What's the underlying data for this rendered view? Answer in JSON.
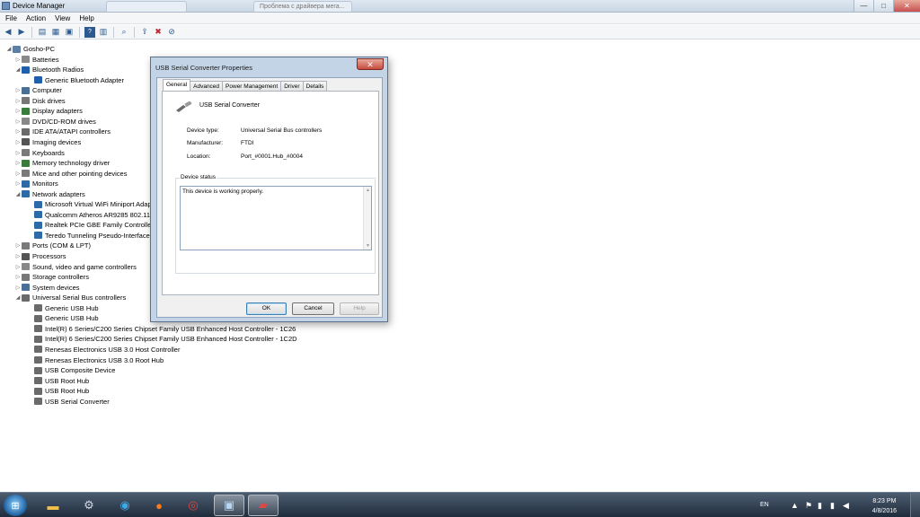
{
  "window": {
    "title": "Device Manager",
    "background_tab_1": "",
    "background_tab_2": "Проблема с драйвера мега...",
    "minimize_glyph": "—",
    "maximize_glyph": "□",
    "close_glyph": "✕"
  },
  "menu": [
    "File",
    "Action",
    "View",
    "Help"
  ],
  "tree": {
    "root": "Gosho-PC",
    "items": [
      {
        "label": "Batteries",
        "level": 1,
        "expander": "▷",
        "icon": "battery-icon",
        "color": "#8a8a8a"
      },
      {
        "label": "Bluetooth Radios",
        "level": 1,
        "expander": "◢",
        "icon": "bluetooth-icon",
        "color": "#1f5fae"
      },
      {
        "label": "Generic Bluetooth Adapter",
        "level": 2,
        "expander": "",
        "icon": "bluetooth-device-icon",
        "color": "#1f5fae"
      },
      {
        "label": "Computer",
        "level": 1,
        "expander": "▷",
        "icon": "computer-icon",
        "color": "#4a6f96"
      },
      {
        "label": "Disk drives",
        "level": 1,
        "expander": "▷",
        "icon": "disk-drive-icon",
        "color": "#777777"
      },
      {
        "label": "Display adapters",
        "level": 1,
        "expander": "▷",
        "icon": "display-adapter-icon",
        "color": "#3a7d3a"
      },
      {
        "label": "DVD/CD-ROM drives",
        "level": 1,
        "expander": "▷",
        "icon": "dvd-drive-icon",
        "color": "#888888"
      },
      {
        "label": "IDE ATA/ATAPI controllers",
        "level": 1,
        "expander": "▷",
        "icon": "ide-controller-icon",
        "color": "#6a6a6a"
      },
      {
        "label": "Imaging devices",
        "level": 1,
        "expander": "▷",
        "icon": "camera-icon",
        "color": "#555555"
      },
      {
        "label": "Keyboards",
        "level": 1,
        "expander": "▷",
        "icon": "keyboard-icon",
        "color": "#7a7a7a"
      },
      {
        "label": "Memory technology driver",
        "level": 1,
        "expander": "▷",
        "icon": "memory-icon",
        "color": "#3a7d3a"
      },
      {
        "label": "Mice and other pointing devices",
        "level": 1,
        "expander": "▷",
        "icon": "mouse-icon",
        "color": "#7a7a7a"
      },
      {
        "label": "Monitors",
        "level": 1,
        "expander": "▷",
        "icon": "monitor-icon",
        "color": "#2d6aa8"
      },
      {
        "label": "Network adapters",
        "level": 1,
        "expander": "◢",
        "icon": "network-adapter-icon",
        "color": "#2d6aa8"
      },
      {
        "label": "Microsoft Virtual WiFi Miniport Adapter",
        "level": 2,
        "expander": "",
        "icon": "network-card-icon",
        "color": "#2d6aa8"
      },
      {
        "label": "Qualcomm Atheros AR9285 802.11b/g/n WiFi Adapter",
        "level": 2,
        "expander": "",
        "icon": "network-card-icon",
        "color": "#2d6aa8"
      },
      {
        "label": "Realtek PCIe GBE Family Controller",
        "level": 2,
        "expander": "",
        "icon": "network-card-icon",
        "color": "#2d6aa8"
      },
      {
        "label": "Teredo Tunneling Pseudo-Interface",
        "level": 2,
        "expander": "",
        "icon": "network-card-icon",
        "color": "#2d6aa8"
      },
      {
        "label": "Ports (COM & LPT)",
        "level": 1,
        "expander": "▷",
        "icon": "port-icon",
        "color": "#7a7a7a"
      },
      {
        "label": "Processors",
        "level": 1,
        "expander": "▷",
        "icon": "processor-icon",
        "color": "#555555"
      },
      {
        "label": "Sound, video and game controllers",
        "level": 1,
        "expander": "▷",
        "icon": "speaker-icon",
        "color": "#888888"
      },
      {
        "label": "Storage controllers",
        "level": 1,
        "expander": "▷",
        "icon": "storage-controller-icon",
        "color": "#777777"
      },
      {
        "label": "System devices",
        "level": 1,
        "expander": "▷",
        "icon": "system-device-icon",
        "color": "#4a6f96"
      },
      {
        "label": "Universal Serial Bus controllers",
        "level": 1,
        "expander": "◢",
        "icon": "usb-controller-icon",
        "color": "#6a6a6a"
      },
      {
        "label": "Generic USB Hub",
        "level": 2,
        "expander": "",
        "icon": "usb-plug-icon",
        "color": "#6a6a6a"
      },
      {
        "label": "Generic USB Hub",
        "level": 2,
        "expander": "",
        "icon": "usb-plug-icon",
        "color": "#6a6a6a"
      },
      {
        "label": "Intel(R) 6 Series/C200 Series Chipset Family USB Enhanced Host Controller - 1C26",
        "level": 2,
        "expander": "",
        "icon": "usb-plug-icon",
        "color": "#6a6a6a"
      },
      {
        "label": "Intel(R) 6 Series/C200 Series Chipset Family USB Enhanced Host Controller - 1C2D",
        "level": 2,
        "expander": "",
        "icon": "usb-plug-icon",
        "color": "#6a6a6a"
      },
      {
        "label": "Renesas Electronics USB 3.0 Host Controller",
        "level": 2,
        "expander": "",
        "icon": "usb-plug-icon",
        "color": "#6a6a6a"
      },
      {
        "label": "Renesas Electronics USB 3.0 Root Hub",
        "level": 2,
        "expander": "",
        "icon": "usb-plug-icon",
        "color": "#6a6a6a"
      },
      {
        "label": "USB Composite Device",
        "level": 2,
        "expander": "",
        "icon": "usb-plug-icon",
        "color": "#6a6a6a"
      },
      {
        "label": "USB Root Hub",
        "level": 2,
        "expander": "",
        "icon": "usb-plug-icon",
        "color": "#6a6a6a"
      },
      {
        "label": "USB Root Hub",
        "level": 2,
        "expander": "",
        "icon": "usb-plug-icon",
        "color": "#6a6a6a"
      },
      {
        "label": "USB Serial Converter",
        "level": 2,
        "expander": "",
        "icon": "usb-plug-icon",
        "color": "#6a6a6a"
      }
    ]
  },
  "dialog": {
    "title": "USB Serial Converter Properties",
    "close_glyph": "✕",
    "tabs": [
      "General",
      "Advanced",
      "Power Management",
      "Driver",
      "Details"
    ],
    "active_tab": "General",
    "device_name": "USB Serial Converter",
    "device_type_label": "Device type:",
    "device_type_value": "Universal Serial Bus controllers",
    "manufacturer_label": "Manufacturer:",
    "manufacturer_value": "FTDI",
    "location_label": "Location:",
    "location_value": "Port_#0001.Hub_#0004",
    "status_group_label": "Device status",
    "status_text": "This device is working properly.",
    "ok_label": "OK",
    "cancel_label": "Cancel",
    "help_label": "Help"
  },
  "taskbar": {
    "apps": [
      "explorer",
      "device-manager-tool",
      "messenger",
      "firefox",
      "chrome",
      "remote-desktop",
      "toolbox"
    ],
    "language": "EN",
    "time": "8:23 PM",
    "date": "4/8/2016"
  }
}
